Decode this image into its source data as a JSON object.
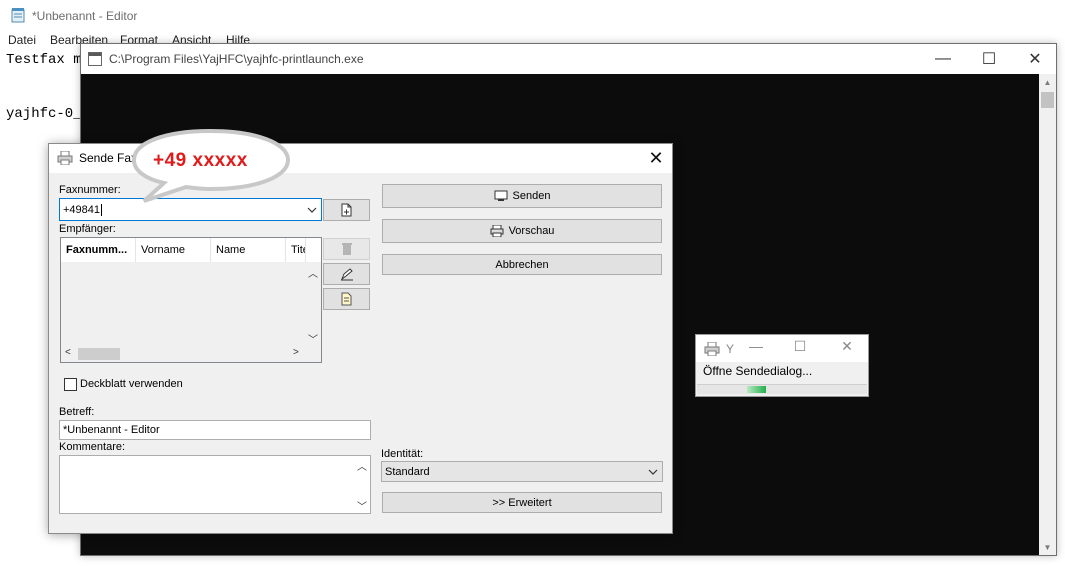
{
  "notepad": {
    "title": "*Unbenannt - Editor",
    "menu": [
      "Datei",
      "Bearbeiten",
      "Format",
      "Ansicht",
      "Hilfe"
    ],
    "lines": [
      "Testfax m",
      "yajhfc-0_"
    ]
  },
  "console": {
    "title": "C:\\Program Files\\YajHFC\\yajhfc-printlaunch.exe",
    "minimize": "—",
    "maximize": "☐",
    "close": "✕"
  },
  "progress": {
    "title": "Y",
    "minimize": "—",
    "maximize": "☐",
    "close": "✕",
    "label": "Öffne Sendedialog...",
    "value": 0.11
  },
  "dialog": {
    "title": "Sende Fax",
    "close": "✕",
    "fax_label": "Faxnummer:",
    "fax_value": "+49841",
    "recipients_label": "Empfänger:",
    "columns": [
      "Faxnumm...",
      "Vorname",
      "Name",
      "Tite"
    ],
    "coverpage_label": "Deckblatt verwenden",
    "subject_label": "Betreff:",
    "subject_value": "*Unbenannt - Editor",
    "comments_label": "Kommentare:",
    "identity_label": "Identität:",
    "identity_value": "Standard",
    "send_button": "Senden",
    "preview_button": "Vorschau",
    "cancel_button": "Abbrechen",
    "advanced_button": ">> Erweitert"
  },
  "annotation": {
    "text": "+49 xxxxx",
    "color": "#e01b1b"
  }
}
